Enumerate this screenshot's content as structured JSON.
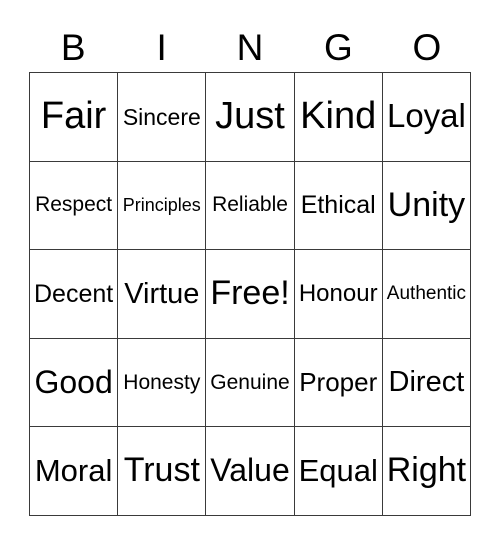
{
  "card": {
    "title": "BINGO",
    "headers": [
      "B",
      "I",
      "N",
      "G",
      "O"
    ],
    "rows": [
      [
        {
          "text": "Fair"
        },
        {
          "text": "Sincere"
        },
        {
          "text": "Just"
        },
        {
          "text": "Kind"
        },
        {
          "text": "Loyal"
        }
      ],
      [
        {
          "text": "Respect"
        },
        {
          "text": "Principles"
        },
        {
          "text": "Reliable"
        },
        {
          "text": "Ethical"
        },
        {
          "text": "Unity"
        }
      ],
      [
        {
          "text": "Decent"
        },
        {
          "text": "Virtue"
        },
        {
          "text": "Free!"
        },
        {
          "text": "Honour"
        },
        {
          "text": "Authentic"
        }
      ],
      [
        {
          "text": "Good"
        },
        {
          "text": "Honesty"
        },
        {
          "text": "Genuine"
        },
        {
          "text": "Proper"
        },
        {
          "text": "Direct"
        }
      ],
      [
        {
          "text": "Moral"
        },
        {
          "text": "Trust"
        },
        {
          "text": "Value"
        },
        {
          "text": "Equal"
        },
        {
          "text": "Right"
        }
      ]
    ],
    "free_space": "Free!",
    "colors": {
      "background": "#ffffff",
      "text": "#000000",
      "border": "#3a3a3a"
    }
  }
}
